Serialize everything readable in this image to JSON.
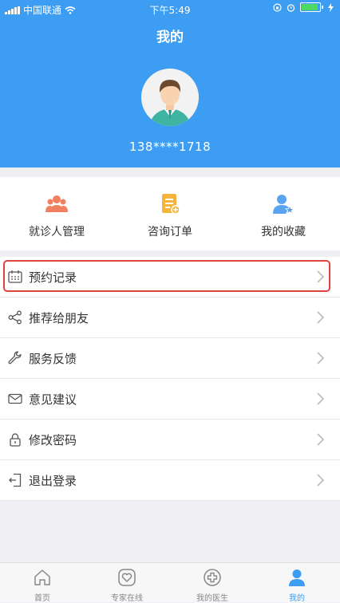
{
  "statusbar": {
    "carrier": "中国联通",
    "time": "下午5:49"
  },
  "header": {
    "title": "我的",
    "phone": "138****1718"
  },
  "colors": {
    "primary": "#3d9df2",
    "highlight": "#e0443e",
    "quick_icon_1": "#f08060",
    "quick_icon_2": "#f5b53a",
    "quick_icon_3": "#5aa3ee"
  },
  "quick": [
    {
      "label": "就诊人管理",
      "icon": "people-icon"
    },
    {
      "label": "咨询订单",
      "icon": "order-icon"
    },
    {
      "label": "我的收藏",
      "icon": "favorite-user-icon"
    }
  ],
  "menu": [
    {
      "label": "预约记录",
      "icon": "calendar-icon"
    },
    {
      "label": "推荐给朋友",
      "icon": "share-icon"
    },
    {
      "label": "服务反馈",
      "icon": "wrench-icon"
    },
    {
      "label": "意见建议",
      "icon": "mail-icon"
    },
    {
      "label": "修改密码",
      "icon": "lock-icon"
    },
    {
      "label": "退出登录",
      "icon": "logout-icon"
    }
  ],
  "tabs": [
    {
      "label": "首页",
      "icon": "home-icon"
    },
    {
      "label": "专家在线",
      "icon": "heart-icon"
    },
    {
      "label": "我的医生",
      "icon": "medical-cross-icon"
    },
    {
      "label": "我的",
      "icon": "person-icon",
      "active": true
    }
  ]
}
